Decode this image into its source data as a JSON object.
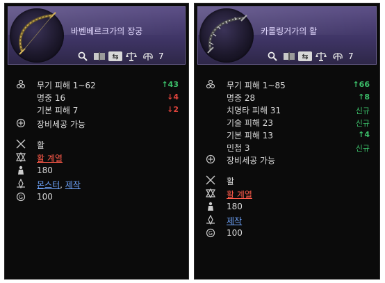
{
  "left": {
    "title": "바벤베르크가의 장궁",
    "toolbar": {
      "count": "7"
    },
    "stats": [
      {
        "label": "무기 피해 1~62",
        "change": "↑43",
        "kind": "up"
      },
      {
        "label": "명중 16",
        "change": "↓4",
        "kind": "down"
      },
      {
        "label": "기본 피해 7",
        "change": "↓2",
        "kind": "down"
      }
    ],
    "enchant": "장비세공 가능",
    "weapon_type": "활",
    "skill_line": "활 계열",
    "level": "180",
    "source_a": "몬스터",
    "source_sep": ",",
    "source_b": "제작",
    "price": "100"
  },
  "right": {
    "title": "카롤링거가의 활",
    "toolbar": {
      "count": "7"
    },
    "stats": [
      {
        "label": "무기 피해 1~85",
        "change": "↑66",
        "kind": "up"
      },
      {
        "label": "명중 28",
        "change": "↑8",
        "kind": "up"
      },
      {
        "label": "치명타 피해 31",
        "change": "신규",
        "kind": "new"
      },
      {
        "label": "기술 피해 23",
        "change": "신규",
        "kind": "new"
      },
      {
        "label": "기본 피해 13",
        "change": "↑4",
        "kind": "up"
      },
      {
        "label": "민첩 3",
        "change": "신규",
        "kind": "new"
      }
    ],
    "enchant": "장비세공 가능",
    "weapon_type": "활",
    "skill_line": "활 계열",
    "level": "180",
    "source": "제작",
    "price": "100"
  },
  "colors": {
    "header": "#4a3f72",
    "up": "#3cc06a",
    "down": "#e0443c",
    "link_red": "#ff5a4a",
    "link_blue": "#6fa6ff"
  }
}
